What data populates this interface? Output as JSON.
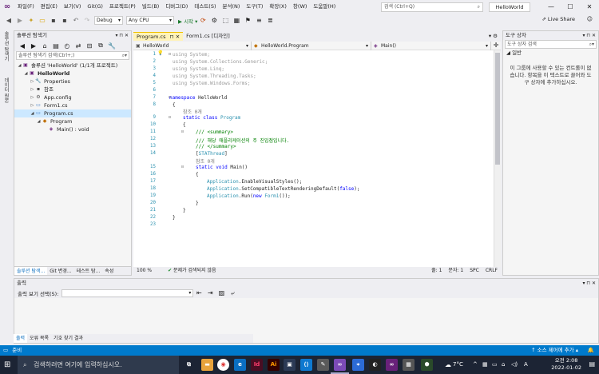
{
  "menu": {
    "items": [
      "파일(F)",
      "편집(E)",
      "보기(V)",
      "Git(G)",
      "프로젝트(P)",
      "빌드(B)",
      "디버그(D)",
      "테스트(S)",
      "분석(N)",
      "도구(T)",
      "확장(X)",
      "창(W)",
      "도움말(H)"
    ],
    "search_placeholder": "검색 (Ctrl+Q)",
    "solution_title": "HelloWorld"
  },
  "toolbar": {
    "config": "Debug",
    "platform": "Any CPU",
    "start_label": "▶ 시작 ▾",
    "liveshare": "Live Share"
  },
  "leftstrip": [
    "솔루션 탐색기",
    "데이터 원본"
  ],
  "solution_explorer": {
    "title": "솔루션 탐색기",
    "search_placeholder": "솔루션 탐색기 검색(Ctrl+;)",
    "items": [
      {
        "label": "솔루션 'HelloWorld' (1/1개 프로젝트)",
        "indent": 0
      },
      {
        "label": "HelloWorld",
        "indent": 1,
        "bold": true
      },
      {
        "label": "Properties",
        "indent": 2
      },
      {
        "label": "참조",
        "indent": 2
      },
      {
        "label": "App.config",
        "indent": 2
      },
      {
        "label": "Form1.cs",
        "indent": 2
      },
      {
        "label": "Program.cs",
        "indent": 2,
        "selected": true
      },
      {
        "label": "Program",
        "indent": 3
      },
      {
        "label": "Main() : void",
        "indent": 4
      }
    ],
    "tabs": [
      "솔루션 탐색...",
      "Git 변경...",
      "테스트 탐...",
      "속성"
    ]
  },
  "editor": {
    "tabs": [
      {
        "label": "Program.cs",
        "active": true
      },
      {
        "label": "Form1.cs [디자인]",
        "active": false
      }
    ],
    "nav": [
      "HelloWorld",
      "HelloWorld.Program",
      "Main()"
    ],
    "line_numbers": [
      "1",
      "2",
      "3",
      "4",
      "5",
      "6",
      "7",
      "8",
      "9",
      "10",
      "11",
      "12",
      "13",
      "14",
      "15",
      "16",
      "17",
      "18",
      "19",
      "20",
      "21",
      "22",
      "23"
    ],
    "status": {
      "zoom": "100 %",
      "issues": "문제가 검색되지 않음",
      "line": "줄: 1",
      "col": "문자: 1",
      "mode": "SPC",
      "eol": "CRLF"
    }
  },
  "toolbox": {
    "title": "도구 상자",
    "search_placeholder": "도구 상자 검색",
    "group": "일반",
    "message": "이 그룹에 사용할 수 있는 컨트롤이 없습니다. 항목을 이 텍스트로 끌어와 도구 상자에 추가하십시오."
  },
  "output": {
    "title": "출력",
    "source_label": "출력 보기 선택(S):",
    "tabs": [
      "출력",
      "오류 목록",
      "기호 찾기 결과"
    ]
  },
  "statusbar": {
    "left": "준비",
    "right": "↑ 소스 제어에 추가 ▴"
  },
  "taskbar": {
    "search_placeholder": "검색하려면 여기에 입력하십시오.",
    "weather": "7°C",
    "time": "오전 2:08",
    "date": "2022-01-02"
  }
}
